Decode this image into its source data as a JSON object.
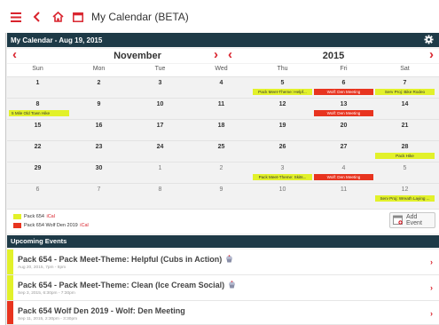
{
  "app": {
    "title": "My Calendar (BETA)"
  },
  "colors": {
    "accent": "#d9232d",
    "header_bg": "#1e3a47",
    "yellow": "#e2f12a",
    "red": "#e8341f"
  },
  "calendar": {
    "header": "My Calendar - Aug 19, 2015",
    "month": "November",
    "year": "2015",
    "dow": [
      "Sun",
      "Mon",
      "Tue",
      "Wed",
      "Thu",
      "Fri",
      "Sat"
    ],
    "weeks": [
      {
        "days": [
          "1",
          "2",
          "3",
          "4",
          "5",
          "6",
          "7"
        ]
      },
      {
        "days": [
          "8",
          "9",
          "10",
          "11",
          "12",
          "13",
          "14"
        ]
      },
      {
        "days": [
          "15",
          "16",
          "17",
          "18",
          "19",
          "20",
          "21"
        ]
      },
      {
        "days": [
          "22",
          "23",
          "24",
          "25",
          "26",
          "27",
          "28"
        ]
      },
      {
        "days": [
          "29",
          "30",
          "1",
          "2",
          "3",
          "4",
          "5"
        ]
      },
      {
        "days": [
          "6",
          "7",
          "8",
          "9",
          "10",
          "11",
          "12"
        ]
      }
    ],
    "events": {
      "w0_thu": "Pack Meet-Theme: Helpf...",
      "w0_fri": "Wolf: Den Meeting",
      "w0_sat": "Serv Proj: Bike Rodeo",
      "w1_sun": "5 Mile Old Town Hike",
      "w1_fri": "Wolf: Den Meeting",
      "w3_sat": "Pack Hike",
      "w4_thu": "Pack Meet-Theme: Skits...",
      "w4_fri": "Wolf: Den Meeting",
      "w5_sat": "Serv Proj: Wreath Laying ..."
    }
  },
  "legend": {
    "items": [
      {
        "label": "Pack 654",
        "link": "iCal"
      },
      {
        "label": "Pack 654 Wolf Den 2019",
        "link": "iCal"
      }
    ],
    "add_event": "Add Event"
  },
  "upcoming": {
    "header": "Upcoming Events",
    "items": [
      {
        "title": "Pack 654 - Pack Meet-Theme: Helpful (Cubs in Action)",
        "sub": "Aug 20, 2015, 7pm - 8pm"
      },
      {
        "title": "Pack 654 - Pack Meet-Theme: Clean (Ice Cream Social)",
        "sub": "Sep 3, 2015, 6:30pm - 7:30pm"
      },
      {
        "title": "Pack 654 Wolf Den 2019 - Wolf: Den Meeting",
        "sub": "Sep 11, 2015, 2:30pm - 3:30pm"
      }
    ]
  },
  "icons": [
    "menu-icon",
    "back-icon",
    "home-icon",
    "calendar-icon",
    "gear-icon",
    "cupcake-icon",
    "chevron-right-icon"
  ]
}
